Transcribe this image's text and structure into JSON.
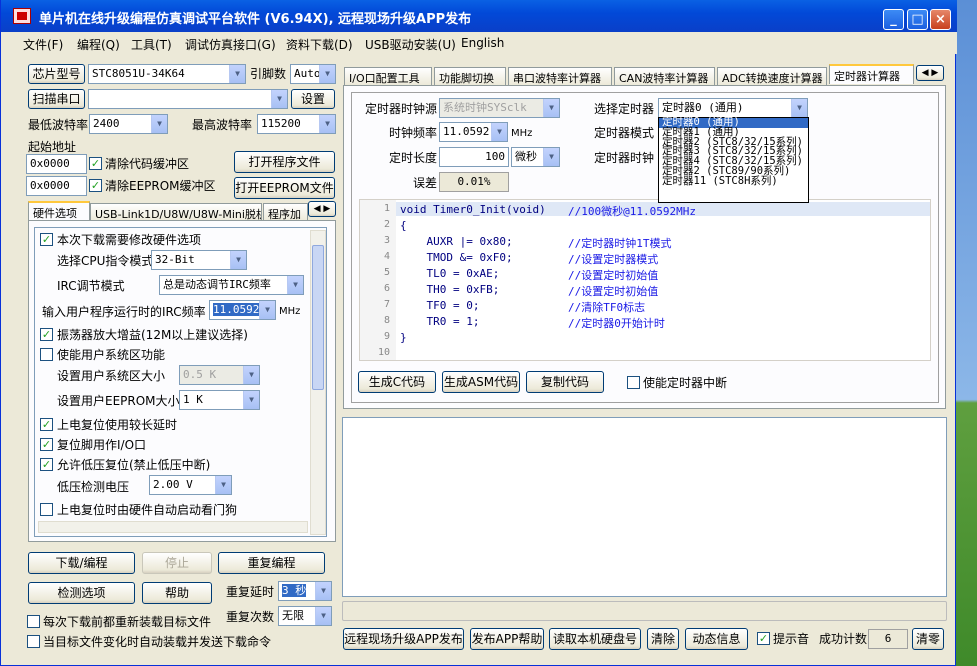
{
  "window": {
    "title": "单片机在线升级编程仿真调试平台软件 (V6.94X), 远程现场升级APP发布",
    "min": "_",
    "max": "□",
    "close": "×"
  },
  "menu": [
    "文件(F)",
    "编程(Q)",
    "工具(T)",
    "调试仿真接口(G)",
    "资料下载(D)",
    "USB驱动安装(U)",
    "English"
  ],
  "left": {
    "chip_btn": "芯片型号",
    "chip_value": "STC8051U-34K64",
    "pin_label": "引脚数",
    "pin_value": "Auto",
    "scan_btn": "扫描串口",
    "port_value": "",
    "settings_btn": "设置",
    "min_baud_label": "最低波特率",
    "min_baud": "2400",
    "max_baud_label": "最高波特率",
    "max_baud": "115200",
    "start_addr_label": "起始地址",
    "addr1": "0x0000",
    "clear_code": "清除代码缓冲区",
    "open_prog": "打开程序文件",
    "addr2": "0x0000",
    "clear_eeprom": "清除EEPROM缓冲区",
    "open_eeprom": "打开EEPROM文件",
    "tabs": [
      "硬件选项",
      "USB-Link1D/U8W/U8W-Mini脱机",
      "程序加"
    ],
    "hw": {
      "reprogram": "本次下载需要修改硬件选项",
      "cpu_label": "选择CPU指令模式",
      "cpu_value": "32-Bit",
      "irc_label": "IRC调节模式",
      "irc_value": "总是动态调节IRC频率",
      "freq_label": "输入用户程序运行时的IRC频率",
      "freq_value": "11.0592",
      "freq_unit": "MHz",
      "osc": "振荡器放大增益(12M以上建议选择)",
      "user_sys": "使能用户系统区功能",
      "user_sys_size_label": "设置用户系统区大小",
      "user_sys_size": "0.5 K",
      "eeprom_label": "设置用户EEPROM大小",
      "eeprom_value": "1  K",
      "long_delay": "上电复位使用较长延时",
      "reset_io": "复位脚用作I/O口",
      "lvr": "允许低压复位(禁止低压中断)",
      "lv_label": "低压检测电压",
      "lv_value": "2.00 V",
      "wdt": "上电复位时由硬件自动启动看门狗"
    },
    "download_btn": "下载/编程",
    "stop_btn": "停止",
    "reprog_btn": "重复编程",
    "detect_btn": "检测选项",
    "help_btn": "帮助",
    "delay_label": "重复延时",
    "delay_value": "3 秒",
    "count_label": "重复次数",
    "count_value": "无限",
    "reload": "每次下载前都重新装载目标文件",
    "auto_send": "当目标文件变化时自动装载并发送下载命令"
  },
  "right": {
    "tabs": [
      "I/O口配置工具",
      "功能脚切换",
      "串口波特率计算器",
      "CAN波特率计算器",
      "ADC转换速度计算器",
      "定时器计算器"
    ],
    "clk_src_label": "定时器时钟源",
    "clk_src": "系统时钟SYSclk",
    "sel_timer_label": "选择定时器",
    "sel_timer": "定时器0 (通用)",
    "freq_label": "时钟频率",
    "freq_value": "11.0592",
    "freq_unit": "MHz",
    "mode_label": "定时器模式",
    "len_label": "定时长度",
    "len_value": "100",
    "len_unit": "微秒",
    "tclk_label": "定时器时钟",
    "err_label": "误差",
    "err_value": "0.01%",
    "dropdown": [
      "定时器0 (通用)",
      "定时器1 (通用)",
      "定时器2 (STC8/32/15系列)",
      "定时器3 (STC8/32/15系列)",
      "定时器4 (STC8/32/15系列)",
      "定时器2 (STC89/90系列)",
      "定时器11 (STC8H系列)"
    ],
    "code": [
      {
        "n": "1",
        "c": "void Timer0_Init(void)",
        "m": "//100微秒@11.0592MHz"
      },
      {
        "n": "2",
        "c": "{",
        "m": ""
      },
      {
        "n": "3",
        "c": "    AUXR |= 0x80;",
        "m": "//定时器时钟1T模式"
      },
      {
        "n": "4",
        "c": "    TMOD &= 0xF0;",
        "m": "//设置定时器模式"
      },
      {
        "n": "5",
        "c": "    TL0 = 0xAE;",
        "m": "//设置定时初始值"
      },
      {
        "n": "6",
        "c": "    TH0 = 0xFB;",
        "m": "//设置定时初始值"
      },
      {
        "n": "7",
        "c": "    TF0 = 0;",
        "m": "//清除TF0标志"
      },
      {
        "n": "8",
        "c": "    TR0 = 1;",
        "m": "//定时器0开始计时"
      },
      {
        "n": "9",
        "c": "}",
        "m": ""
      },
      {
        "n": "10",
        "c": "",
        "m": ""
      }
    ],
    "gen_c": "生成C代码",
    "gen_asm": "生成ASM代码",
    "copy": "复制代码",
    "enable_int": "使能定时器中断"
  },
  "bottom": {
    "remote": "远程现场升级APP发布",
    "app_help": "发布APP帮助",
    "read_disk": "读取本机硬盘号",
    "clear": "清除",
    "dyn": "动态信息",
    "beep": "提示音",
    "success_label": "成功计数",
    "success": "6",
    "reset": "清零"
  }
}
